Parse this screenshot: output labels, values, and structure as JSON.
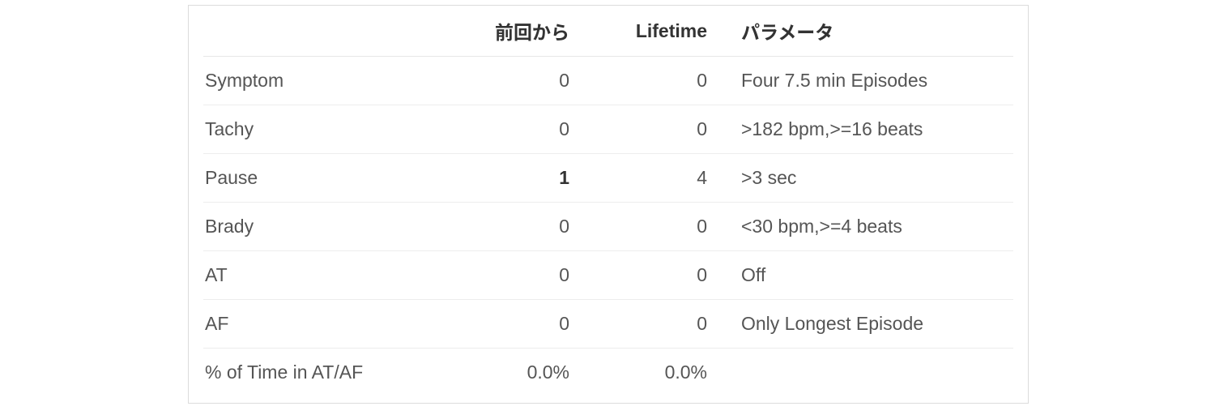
{
  "headers": {
    "label": "",
    "since": "前回から",
    "lifetime": "Lifetime",
    "parameter": "パラメータ"
  },
  "rows": [
    {
      "label": "Symptom",
      "since": "0",
      "sinceBold": false,
      "lifetime": "0",
      "parameter": "Four 7.5 min Episodes"
    },
    {
      "label": "Tachy",
      "since": "0",
      "sinceBold": false,
      "lifetime": "0",
      "parameter": ">182 bpm,>=16 beats"
    },
    {
      "label": "Pause",
      "since": "1",
      "sinceBold": true,
      "lifetime": "4",
      "parameter": ">3 sec"
    },
    {
      "label": "Brady",
      "since": "0",
      "sinceBold": false,
      "lifetime": "0",
      "parameter": "<30 bpm,>=4 beats"
    },
    {
      "label": "AT",
      "since": "0",
      "sinceBold": false,
      "lifetime": "0",
      "parameter": "Off"
    },
    {
      "label": "AF",
      "since": "0",
      "sinceBold": false,
      "lifetime": "0",
      "parameter": "Only Longest Episode"
    },
    {
      "label": "% of Time in AT/AF",
      "since": "0.0%",
      "sinceBold": false,
      "lifetime": "0.0%",
      "parameter": ""
    }
  ]
}
